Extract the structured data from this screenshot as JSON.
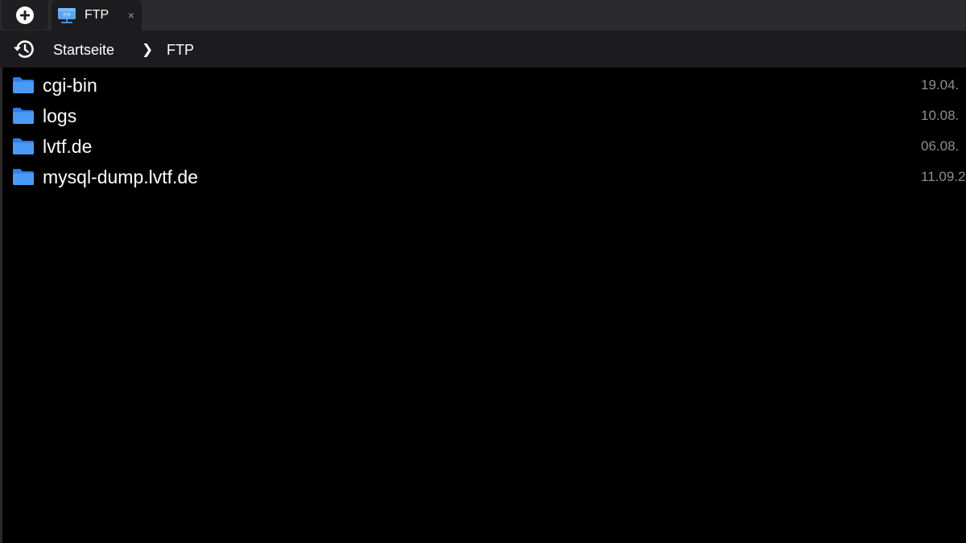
{
  "tabbar": {
    "new_tab_icon": "plus-circle-icon",
    "tabs": [
      {
        "label": "FTP",
        "icon": "ftp-network-icon",
        "icon_text": "FTP",
        "close": "×"
      }
    ]
  },
  "breadcrumb": {
    "history_icon": "history-icon",
    "home_label": "Startseite",
    "separator": "❯",
    "current_label": "FTP"
  },
  "files": [
    {
      "name": "cgi-bin",
      "date": "19.04.",
      "icon": "folder-icon"
    },
    {
      "name": "logs",
      "date": "10.08.",
      "icon": "folder-icon"
    },
    {
      "name": "lvtf.de",
      "date": "06.08.",
      "icon": "folder-icon"
    },
    {
      "name": "mysql-dump.lvtf.de",
      "date": "11.09.2",
      "icon": "folder-icon"
    }
  ],
  "colors": {
    "background": "#000000",
    "tabbar": "#2b2b2d",
    "toolbar": "#1c1c1e",
    "folder": "#3c8ff7",
    "text": "#ffffff",
    "muted_text": "#8e8e93"
  }
}
